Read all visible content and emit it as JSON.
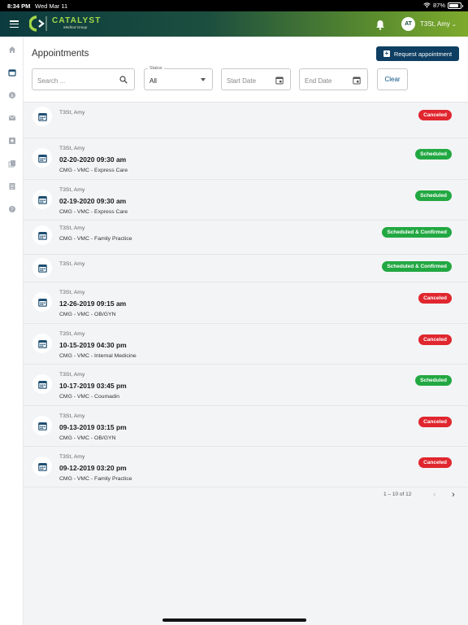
{
  "status_bar": {
    "time": "8:34 PM",
    "date": "Wed Mar 11",
    "battery": "87%"
  },
  "header": {
    "logo_name": "CATALYST",
    "logo_sub": "Medical Group",
    "user_initials": "AT",
    "user_name": "T3St, Amy",
    "chevron": "⌄"
  },
  "sidebar": {
    "items": [
      "home-icon",
      "calendar-icon",
      "billing-icon",
      "messages-icon",
      "health-icon",
      "records-icon",
      "forms-icon",
      "help-icon"
    ]
  },
  "page": {
    "title": "Appointments",
    "request_button": "Request appointment",
    "clear_button": "Clear"
  },
  "filters": {
    "search_placeholder": "Search ...",
    "status_label": "Status",
    "status_value": "All",
    "start_placeholder": "Start Date",
    "end_placeholder": "End Date"
  },
  "appointments": [
    {
      "name": "T3St, Amy",
      "date": "",
      "location": "",
      "status": "Canceled"
    },
    {
      "name": "T3St, Amy",
      "date": "02-20-2020 09:30 am",
      "location": "CMG - VMC - Express Care",
      "status": "Scheduled"
    },
    {
      "name": "T3St, Amy",
      "date": "02-19-2020 09:30 am",
      "location": "CMG - VMC - Express Care",
      "status": "Scheduled"
    },
    {
      "name": "T3St, Amy",
      "date": "",
      "location": "CMG - VMC - Family Practice",
      "status": "Scheduled & Confirmed"
    },
    {
      "name": "T3St, Amy",
      "date": "",
      "location": "",
      "status": "Scheduled & Confirmed"
    },
    {
      "name": "T3St, Amy",
      "date": "12-26-2019 09:15 am",
      "location": "CMG - VMC - OB/GYN",
      "status": "Canceled"
    },
    {
      "name": "T3St, Amy",
      "date": "10-15-2019 04:30 pm",
      "location": "CMG - VMC - Internal Medicine",
      "status": "Canceled"
    },
    {
      "name": "T3St, Amy",
      "date": "10-17-2019 03:45 pm",
      "location": "CMG - VMC - Coumadin",
      "status": "Scheduled"
    },
    {
      "name": "T3St, Amy",
      "date": "09-13-2019 03:15 pm",
      "location": "CMG - VMC - OB/GYN",
      "status": "Canceled"
    },
    {
      "name": "T3St, Amy",
      "date": "09-12-2019 03:20 pm",
      "location": "CMG - VMC - Family Practice",
      "status": "Canceled"
    }
  ],
  "pagination": {
    "text": "1 – 10 of 12",
    "prev": "‹",
    "next": "›"
  },
  "colors": {
    "primary": "#0e3e62",
    "canceled": "#e0262e",
    "scheduled": "#22a842",
    "accent": "#7eaa2c"
  }
}
